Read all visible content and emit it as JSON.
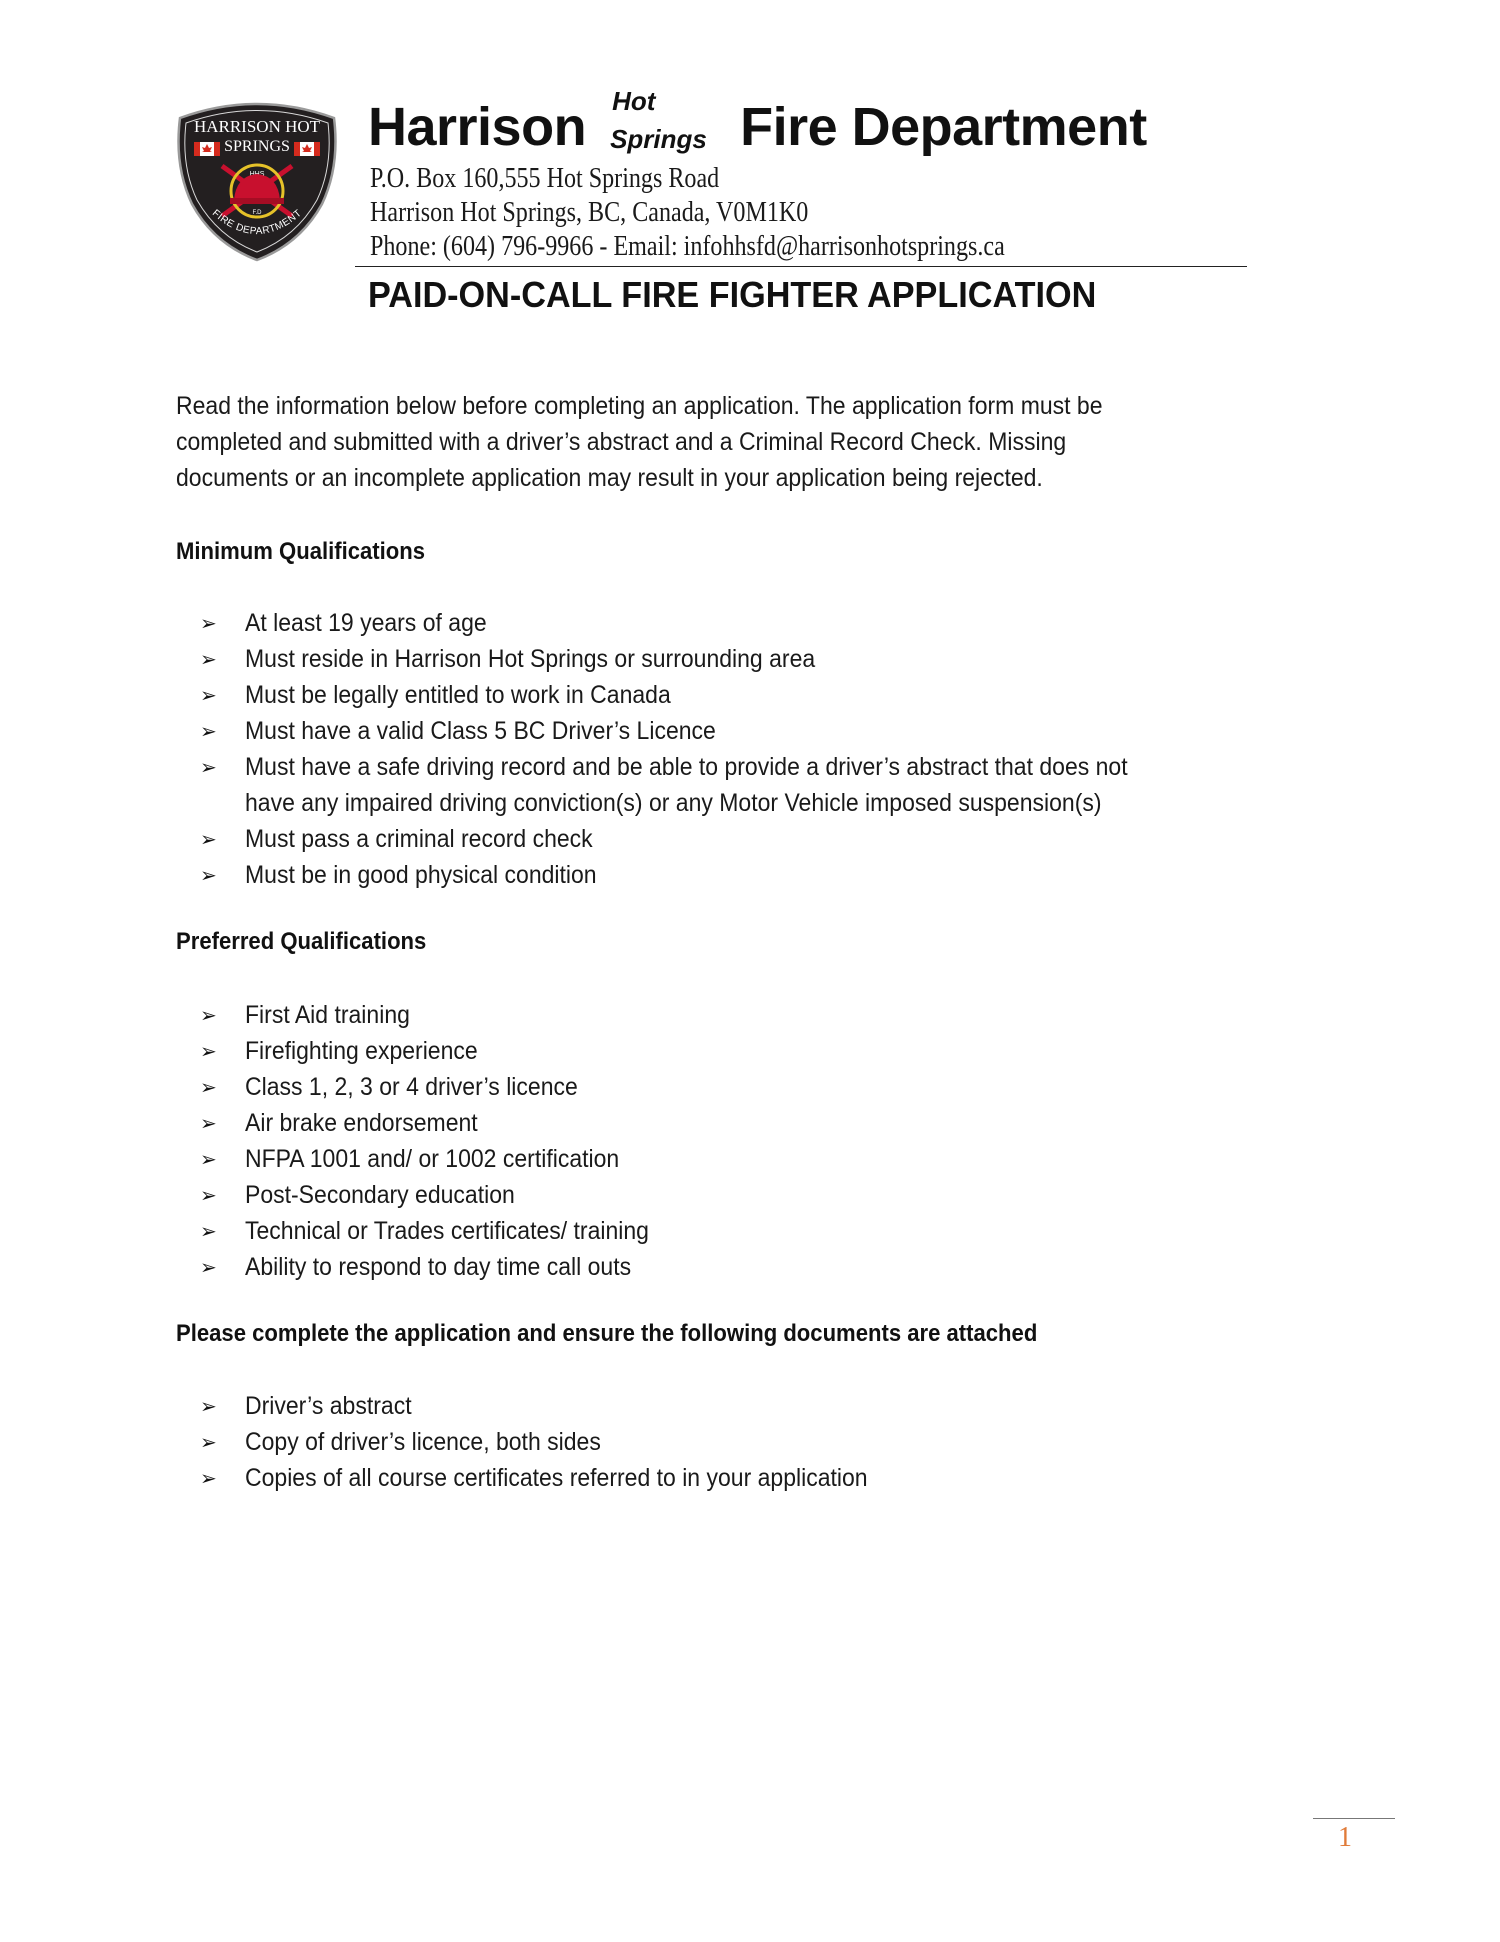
{
  "header": {
    "logo": {
      "icon": "fire-department-badge-icon",
      "top_text": "HARRISON HOT",
      "mid_text": "SPRINGS",
      "inner_top": "HHS",
      "inner_bottom": "F.D",
      "bottom_text": "FIRE DEPARTMENT"
    },
    "title_left": "Harrison",
    "title_hot": "Hot",
    "title_springs": "Springs",
    "title_right": "Fire Department",
    "address_line1": "P.O. Box 160,555 Hot Springs Road",
    "address_line2": "Harrison Hot Springs, BC, Canada, V0M1K0",
    "address_line3": "Phone: (604) 796-9966 - Email: infohhsfd@harrisonhotsprings.ca"
  },
  "document_title": "PAID-ON-CALL FIRE FIGHTER APPLICATION",
  "intro": {
    "lines": [
      "Read the information below before completing an application. The application form must be",
      "completed and submitted with a driver’s abstract and a Criminal Record Check.  Missing",
      "documents or an incomplete application may result in your application being rejected."
    ]
  },
  "bullet_icon": "➢",
  "sections": {
    "minimum": {
      "heading": "Minimum Qualifications",
      "items": [
        {
          "lines": [
            "At least 19 years of age"
          ]
        },
        {
          "lines": [
            "Must reside in Harrison Hot Springs or surrounding area"
          ]
        },
        {
          "lines": [
            "Must be legally entitled to work in Canada"
          ]
        },
        {
          "lines": [
            "Must have a valid Class 5 BC Driver’s Licence"
          ]
        },
        {
          "lines": [
            "Must have a safe driving record and be able to provide a driver’s abstract that does not",
            "have any impaired driving conviction(s) or any Motor Vehicle imposed suspension(s)"
          ]
        },
        {
          "lines": [
            "Must pass a criminal record check"
          ]
        },
        {
          "lines": [
            "Must be in good physical condition"
          ]
        }
      ]
    },
    "preferred": {
      "heading": "Preferred Qualifications",
      "items": [
        {
          "lines": [
            "First Aid training"
          ]
        },
        {
          "lines": [
            "Firefighting experience"
          ]
        },
        {
          "lines": [
            "Class 1, 2, 3 or 4 driver’s licence"
          ]
        },
        {
          "lines": [
            "Air brake endorsement"
          ]
        },
        {
          "lines": [
            "NFPA 1001 and/ or 1002 certification"
          ]
        },
        {
          "lines": [
            "Post-Secondary education"
          ]
        },
        {
          "lines": [
            "Technical or Trades certificates/ training"
          ]
        },
        {
          "lines": [
            "Ability to respond to day time call outs"
          ]
        }
      ]
    },
    "documents": {
      "heading": "Please complete the application and ensure the following documents are attached",
      "items": [
        {
          "lines": [
            "Driver’s abstract"
          ]
        },
        {
          "lines": [
            "Copy of driver’s licence, both sides"
          ]
        },
        {
          "lines": [
            "Copies of all course certificates referred to in your application"
          ]
        }
      ]
    }
  },
  "footer": {
    "page_number": "1",
    "page_number_color": "#e07b39"
  }
}
